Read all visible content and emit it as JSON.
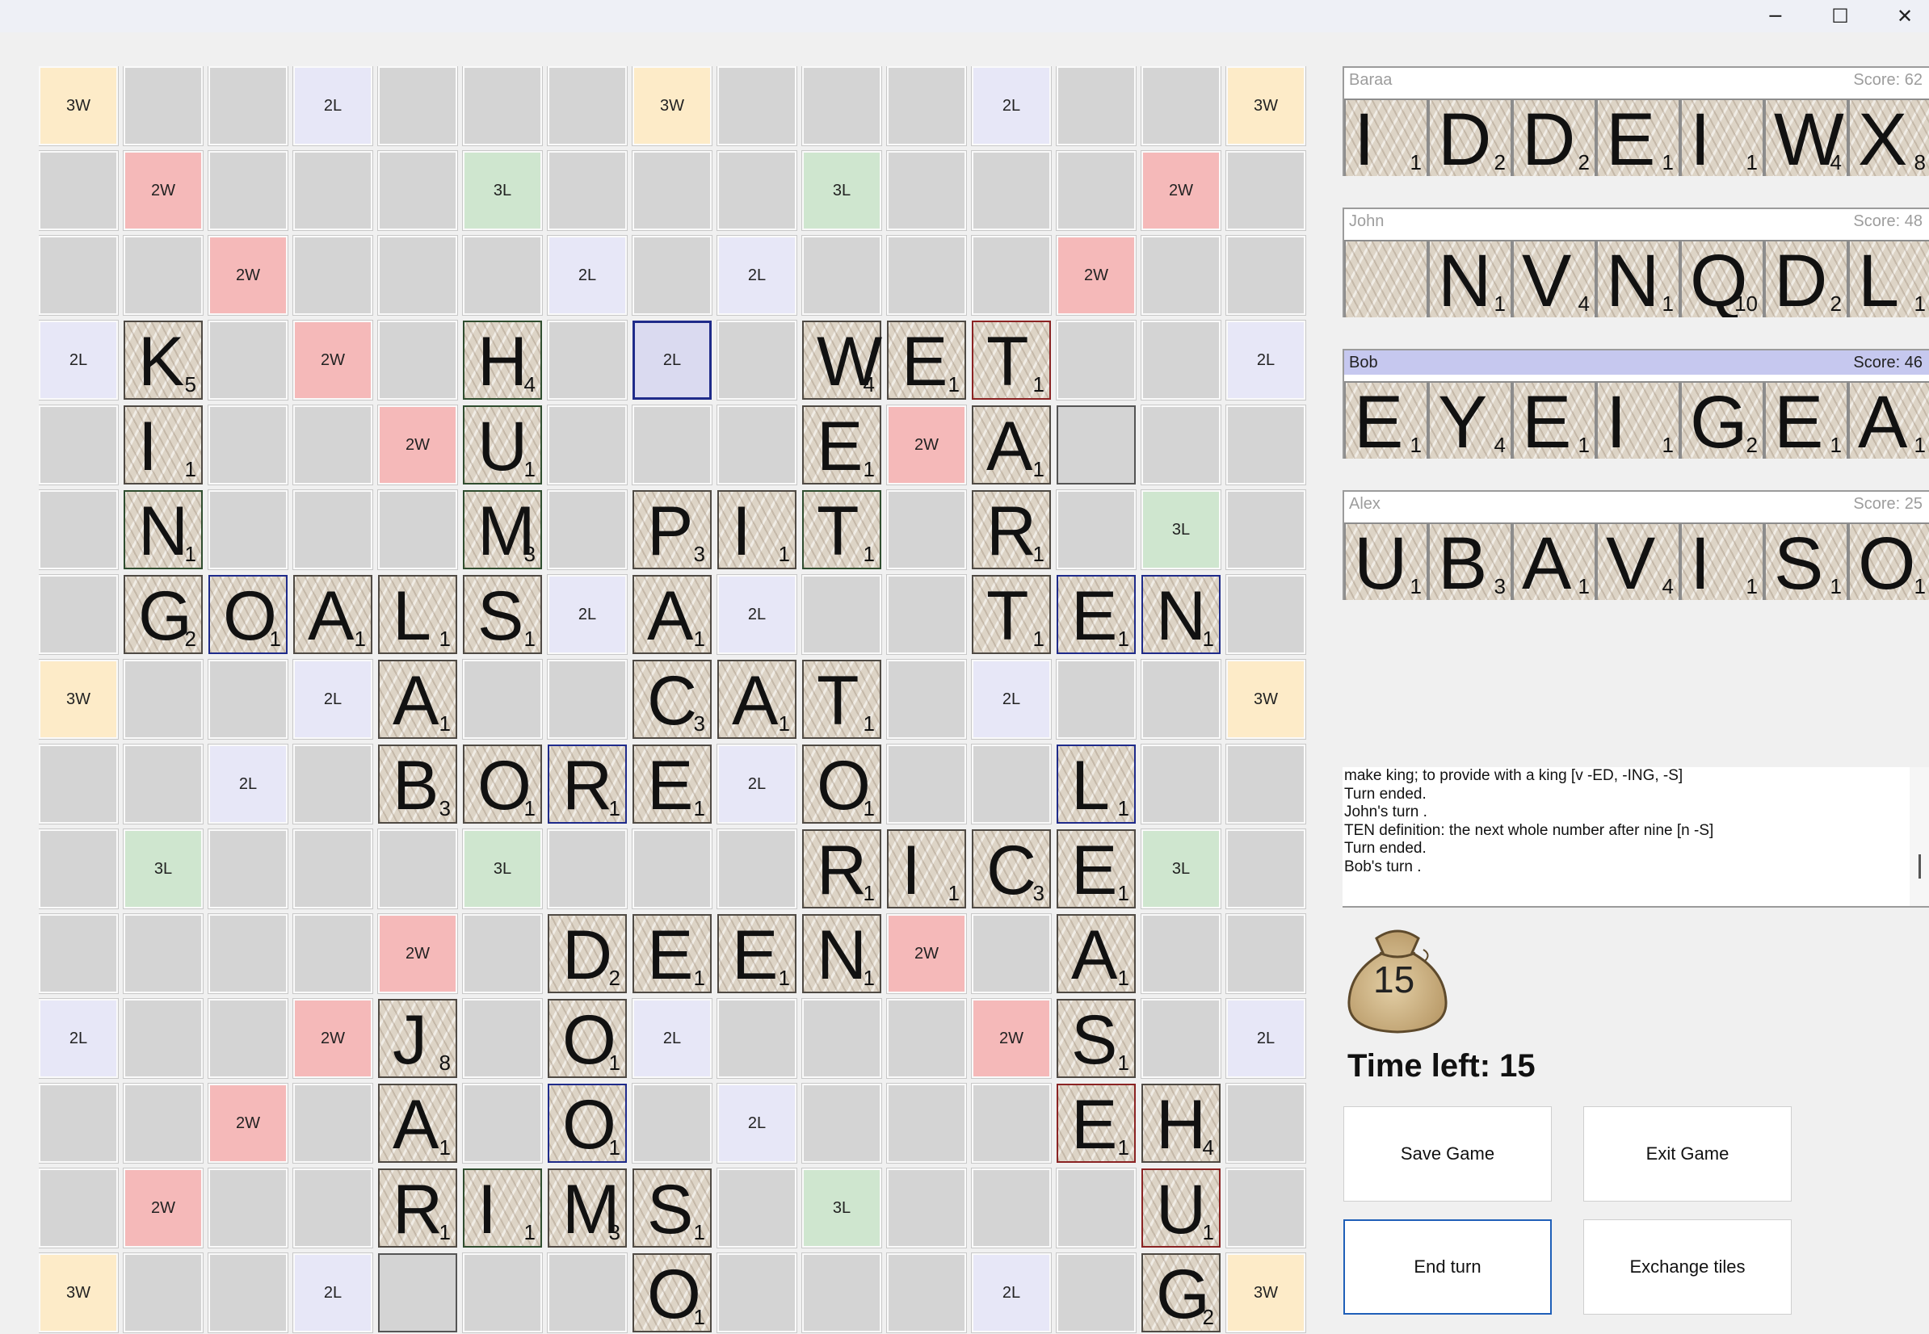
{
  "window": {
    "minimize_glyph": "─",
    "maximize_glyph": "☐",
    "close_glyph": "✕"
  },
  "premium_labels": {
    "3W": "3W",
    "2W": "2W",
    "3L": "3L",
    "2L": "2L"
  },
  "board": {
    "premium_layout": [
      "3W..2L...3W...2L...3W",
      ".2W...3L...3L...2W.",
      "..2W...2L.2L...2W..",
      "2L..2W...2L...2L..2L",
      "....2W.....2W.....",
      ".3L...3L...3L...3L.",
      "..2L...2L.2L...2L..",
      "3W..2L...2L...2L..3W"
    ],
    "premiums": [
      [
        0,
        0,
        "3W"
      ],
      [
        0,
        3,
        "2L"
      ],
      [
        0,
        7,
        "3W"
      ],
      [
        0,
        11,
        "2L"
      ],
      [
        0,
        14,
        "3W"
      ],
      [
        1,
        1,
        "2W"
      ],
      [
        1,
        5,
        "3L"
      ],
      [
        1,
        9,
        "3L"
      ],
      [
        1,
        13,
        "2W"
      ],
      [
        2,
        2,
        "2W"
      ],
      [
        2,
        6,
        "2L"
      ],
      [
        2,
        8,
        "2L"
      ],
      [
        2,
        12,
        "2W"
      ],
      [
        3,
        0,
        "2L"
      ],
      [
        3,
        3,
        "2W"
      ],
      [
        3,
        7,
        "2L"
      ],
      [
        3,
        14,
        "2L"
      ],
      [
        4,
        4,
        "2W"
      ],
      [
        4,
        10,
        "2W"
      ],
      [
        5,
        13,
        "3L"
      ],
      [
        6,
        6,
        "2L"
      ],
      [
        6,
        8,
        "2L"
      ],
      [
        7,
        0,
        "3W"
      ],
      [
        7,
        3,
        "2L"
      ],
      [
        7,
        11,
        "2L"
      ],
      [
        7,
        14,
        "3W"
      ],
      [
        8,
        2,
        "2L"
      ],
      [
        8,
        8,
        "2L"
      ],
      [
        9,
        1,
        "3L"
      ],
      [
        9,
        5,
        "3L"
      ],
      [
        9,
        13,
        "3L"
      ],
      [
        10,
        4,
        "2W"
      ],
      [
        10,
        10,
        "2W"
      ],
      [
        11,
        0,
        "2L"
      ],
      [
        11,
        3,
        "2W"
      ],
      [
        11,
        7,
        "2L"
      ],
      [
        11,
        11,
        "2W"
      ],
      [
        11,
        14,
        "2L"
      ],
      [
        12,
        2,
        "2W"
      ],
      [
        12,
        8,
        "2L"
      ],
      [
        13,
        1,
        "2W"
      ],
      [
        13,
        9,
        "3L"
      ],
      [
        14,
        0,
        "3W"
      ],
      [
        14,
        3,
        "2L"
      ],
      [
        14,
        11,
        "2L"
      ],
      [
        14,
        14,
        "3W"
      ]
    ],
    "tiles": [
      [
        3,
        1,
        "K",
        "5",
        ""
      ],
      [
        3,
        5,
        "H",
        "4",
        "green"
      ],
      [
        3,
        9,
        "W",
        "4",
        ""
      ],
      [
        3,
        10,
        "E",
        "1",
        ""
      ],
      [
        3,
        11,
        "T",
        "1",
        "red"
      ],
      [
        4,
        1,
        "I",
        "1",
        ""
      ],
      [
        4,
        5,
        "U",
        "1",
        "green"
      ],
      [
        4,
        9,
        "E",
        "1",
        ""
      ],
      [
        4,
        11,
        "A",
        "1",
        ""
      ],
      [
        5,
        1,
        "N",
        "1",
        "green"
      ],
      [
        5,
        5,
        "M",
        "3",
        "green"
      ],
      [
        5,
        7,
        "P",
        "3",
        ""
      ],
      [
        5,
        8,
        "I",
        "1",
        ""
      ],
      [
        5,
        9,
        "T",
        "1",
        "green"
      ],
      [
        5,
        11,
        "R",
        "1",
        ""
      ],
      [
        6,
        1,
        "G",
        "2",
        ""
      ],
      [
        6,
        2,
        "O",
        "1",
        "blue"
      ],
      [
        6,
        3,
        "A",
        "1",
        ""
      ],
      [
        6,
        4,
        "L",
        "1",
        ""
      ],
      [
        6,
        5,
        "S",
        "1",
        ""
      ],
      [
        6,
        7,
        "A",
        "1",
        ""
      ],
      [
        6,
        11,
        "T",
        "1",
        ""
      ],
      [
        6,
        12,
        "E",
        "1",
        "blue"
      ],
      [
        6,
        13,
        "N",
        "1",
        "blue"
      ],
      [
        7,
        4,
        "A",
        "1",
        ""
      ],
      [
        7,
        7,
        "C",
        "3",
        ""
      ],
      [
        7,
        8,
        "A",
        "1",
        ""
      ],
      [
        7,
        9,
        "T",
        "1",
        ""
      ],
      [
        8,
        4,
        "B",
        "3",
        ""
      ],
      [
        8,
        5,
        "O",
        "1",
        ""
      ],
      [
        8,
        6,
        "R",
        "1",
        "blue"
      ],
      [
        8,
        7,
        "E",
        "1",
        ""
      ],
      [
        8,
        9,
        "O",
        "1",
        ""
      ],
      [
        8,
        12,
        "L",
        "1",
        "blue"
      ],
      [
        9,
        9,
        "R",
        "1",
        ""
      ],
      [
        9,
        10,
        "I",
        "1",
        ""
      ],
      [
        9,
        11,
        "C",
        "3",
        ""
      ],
      [
        9,
        12,
        "E",
        "1",
        ""
      ],
      [
        10,
        6,
        "D",
        "2",
        ""
      ],
      [
        10,
        7,
        "E",
        "1",
        ""
      ],
      [
        10,
        8,
        "E",
        "1",
        ""
      ],
      [
        10,
        9,
        "N",
        "1",
        ""
      ],
      [
        10,
        12,
        "A",
        "1",
        ""
      ],
      [
        11,
        4,
        "J",
        "8",
        ""
      ],
      [
        11,
        6,
        "O",
        "1",
        ""
      ],
      [
        11,
        12,
        "S",
        "1",
        ""
      ],
      [
        12,
        4,
        "A",
        "1",
        ""
      ],
      [
        12,
        6,
        "O",
        "1",
        "blue"
      ],
      [
        12,
        12,
        "E",
        "1",
        "red"
      ],
      [
        12,
        13,
        "H",
        "4",
        ""
      ],
      [
        13,
        4,
        "R",
        "1",
        ""
      ],
      [
        13,
        5,
        "I",
        "1",
        "green"
      ],
      [
        13,
        6,
        "M",
        "3",
        ""
      ],
      [
        13,
        7,
        "S",
        "1",
        ""
      ],
      [
        13,
        13,
        "U",
        "1",
        "red"
      ],
      [
        14,
        7,
        "O",
        "1",
        ""
      ],
      [
        14,
        13,
        "G",
        "2",
        ""
      ]
    ],
    "selected_cells": [
      [
        3,
        7,
        "blue"
      ],
      [
        4,
        12,
        "dark"
      ],
      [
        14,
        4,
        "dark"
      ]
    ]
  },
  "players": [
    {
      "name": "Baraa",
      "score": "Score: 62",
      "active": false,
      "rack": [
        [
          "I",
          "1"
        ],
        [
          "D",
          "2"
        ],
        [
          "D",
          "2"
        ],
        [
          "E",
          "1"
        ],
        [
          "I",
          "1"
        ],
        [
          "W",
          "4"
        ],
        [
          "X",
          "8"
        ]
      ]
    },
    {
      "name": "John",
      "score": "Score: 48",
      "active": false,
      "rack": [
        [
          "",
          ""
        ],
        [
          "N",
          "1"
        ],
        [
          "V",
          "4"
        ],
        [
          "N",
          "1"
        ],
        [
          "Q",
          "10"
        ],
        [
          "D",
          "2"
        ],
        [
          "L",
          "1"
        ]
      ]
    },
    {
      "name": "Bob",
      "score": "Score: 46",
      "active": true,
      "rack": [
        [
          "E",
          "1"
        ],
        [
          "Y",
          "4"
        ],
        [
          "E",
          "1"
        ],
        [
          "I",
          "1"
        ],
        [
          "G",
          "2"
        ],
        [
          "E",
          "1"
        ],
        [
          "A",
          "1"
        ]
      ]
    },
    {
      "name": "Alex",
      "score": "Score: 25",
      "active": false,
      "rack": [
        [
          "U",
          "1"
        ],
        [
          "B",
          "3"
        ],
        [
          "A",
          "1"
        ],
        [
          "V",
          "4"
        ],
        [
          "I",
          "1"
        ],
        [
          "S",
          "1"
        ],
        [
          "O",
          "1"
        ]
      ]
    }
  ],
  "log": [
    "make king; to provide with a king [v -ED, -ING, -S]",
    "Turn ended.",
    "John's turn .",
    "TEN definition: the next whole number after nine [n -S]",
    "Turn ended.",
    "Bob's turn ."
  ],
  "bag": {
    "count": "15"
  },
  "timer": {
    "label": "Time left: 15"
  },
  "buttons": {
    "save": "Save Game",
    "exit": "Exit Game",
    "end_turn": "End turn",
    "exchange": "Exchange tiles"
  },
  "colors": {
    "active_header": "#c6c8ef",
    "triple_word": "#fdebc8",
    "double_word": "#f5b9b9",
    "triple_letter": "#cfe6cf",
    "double_letter": "#e7e7f7"
  }
}
